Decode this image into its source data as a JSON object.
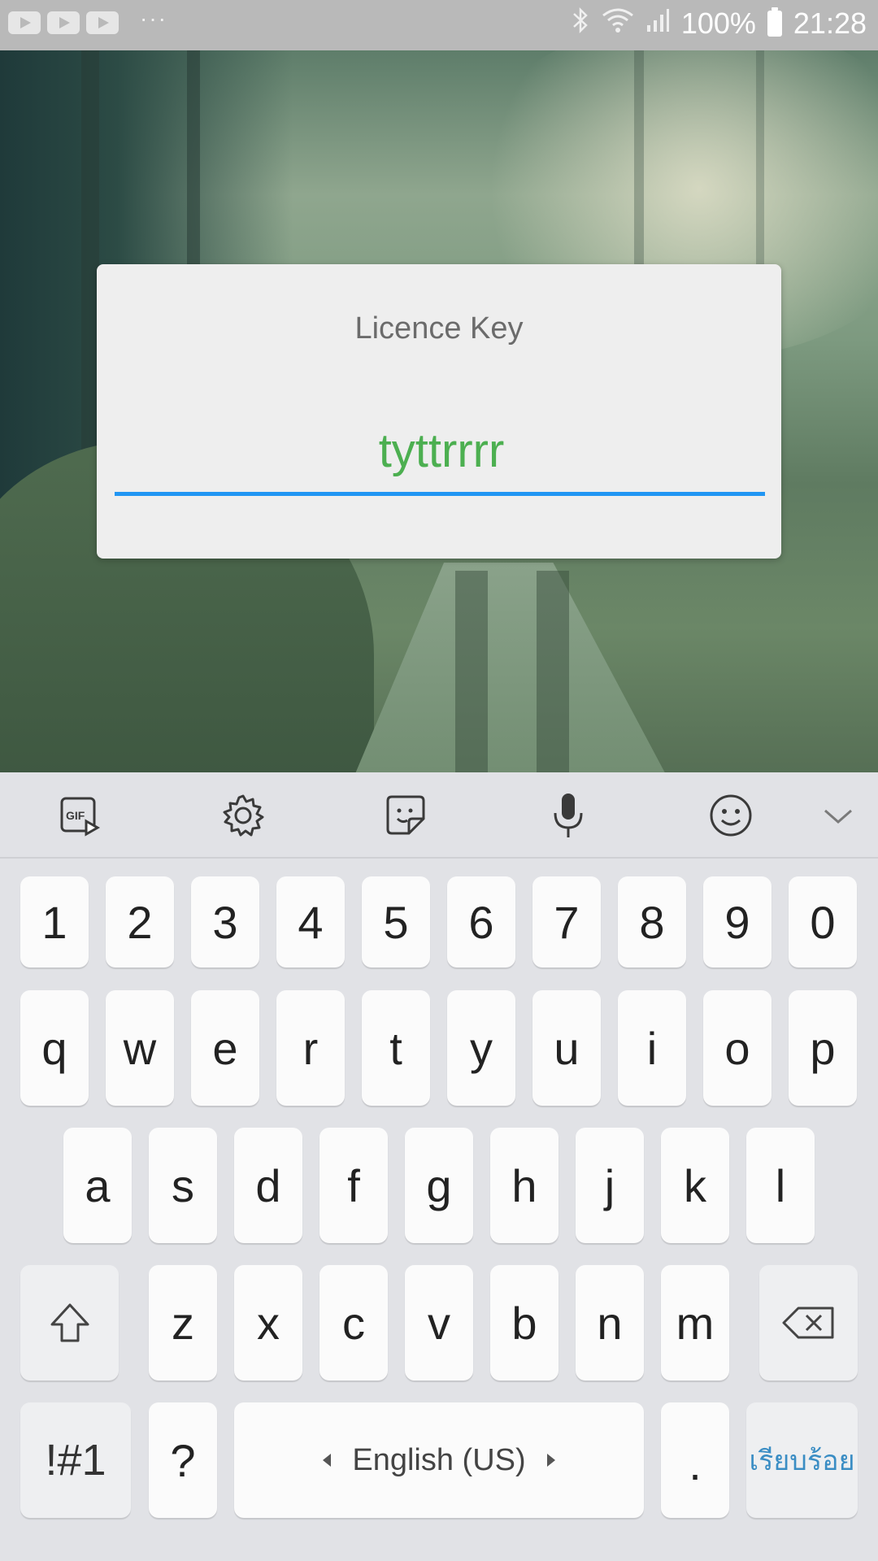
{
  "status_bar": {
    "battery_percent": "100%",
    "time": "21:28",
    "overflow": "···"
  },
  "dialog": {
    "title": "Licence Key",
    "input_value": "tyttrrrr"
  },
  "keyboard": {
    "toolbar": [
      "gif-icon",
      "settings-gear-icon",
      "sticker-icon",
      "microphone-icon",
      "emoji-icon",
      "chevron-down-icon"
    ],
    "row_numbers": [
      "1",
      "2",
      "3",
      "4",
      "5",
      "6",
      "7",
      "8",
      "9",
      "0"
    ],
    "row_q": [
      "q",
      "w",
      "e",
      "r",
      "t",
      "y",
      "u",
      "i",
      "o",
      "p"
    ],
    "row_a": [
      "a",
      "s",
      "d",
      "f",
      "g",
      "h",
      "j",
      "k",
      "l"
    ],
    "row_z": [
      "z",
      "x",
      "c",
      "v",
      "b",
      "n",
      "m"
    ],
    "symbols_label": "!#1",
    "question_label": "?",
    "space_label": "English (US)",
    "period_label": ".",
    "done_label": "เรียบร้อย"
  },
  "colors": {
    "input_text": "#4caf50",
    "input_underline": "#2196f3",
    "done_text": "#3a8dc4"
  }
}
